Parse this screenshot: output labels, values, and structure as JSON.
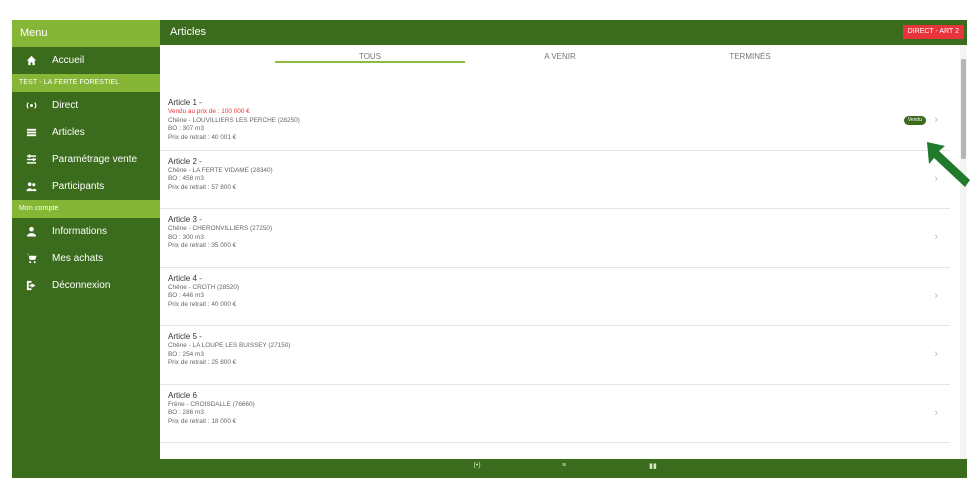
{
  "sidebar": {
    "header": "Menu",
    "items_top": [
      {
        "label": "Accueil",
        "icon": "home-icon"
      }
    ],
    "section_store": "TEST - LA FERTE FORESTIEL",
    "items_mid": [
      {
        "label": "Direct",
        "icon": "broadcast-icon"
      },
      {
        "label": "Articles",
        "icon": "list-icon"
      },
      {
        "label": "Paramétrage vente",
        "icon": "settings-list-icon"
      },
      {
        "label": "Participants",
        "icon": "users-icon"
      }
    ],
    "section_account": "Mon compte",
    "items_bottom": [
      {
        "label": "Informations",
        "icon": "user-icon"
      },
      {
        "label": "Mes achats",
        "icon": "cart-icon"
      },
      {
        "label": "Déconnexion",
        "icon": "logout-icon"
      }
    ]
  },
  "topbar": {
    "title": "Articles",
    "badge": "DIRECT - ART 2"
  },
  "tabs": [
    {
      "label": "TOUS"
    },
    {
      "label": "A VENIR"
    },
    {
      "label": "TERMINÉS"
    }
  ],
  "articles": [
    {
      "title": "Article 1 -",
      "status": "Vendu au prix de : 100 000 €",
      "place": "Chêne - LOUVILLIERS LES PERCHE (28250)",
      "volume": "BO : 307 m3",
      "price": "Prix de retrait : 40 001 €",
      "badge": "Vendu"
    },
    {
      "title": "Article 2 -",
      "status": "",
      "place": "Chêne - LA FERTE VIDAME (28340)",
      "volume": "BO : 458 m3",
      "price": "Prix de retrait : 57 800 €",
      "badge": ""
    },
    {
      "title": "Article 3 -",
      "status": "",
      "place": "Chêne - CHERONVILLIERS (27250)",
      "volume": "BO : 300 m3",
      "price": "Prix de retrait : 35 000 €",
      "badge": ""
    },
    {
      "title": "Article 4 -",
      "status": "",
      "place": "Chêne - CROTH (28520)",
      "volume": "BO : 446 m3",
      "price": "Prix de retrait : 40 000 €",
      "badge": ""
    },
    {
      "title": "Article 5 -",
      "status": "",
      "place": "Chêne - LA LOUPE LES BUISSEY (27150)",
      "volume": "BO : 254 m3",
      "price": "Prix de retrait : 25 800 €",
      "badge": ""
    },
    {
      "title": "Article 6",
      "status": "",
      "place": "Frêne - CROISDALLE (76660)",
      "volume": "BO : 286 m3",
      "price": "Prix de retrait : 18 000 €",
      "badge": ""
    }
  ],
  "chevron": "›",
  "bottombar": [
    "(•)",
    "≡",
    "▮▮"
  ],
  "colors": {
    "dark_green": "#3b6b1c",
    "light_green": "#86b636",
    "red": "#e8343a",
    "arrow": "#1f7a2c"
  }
}
